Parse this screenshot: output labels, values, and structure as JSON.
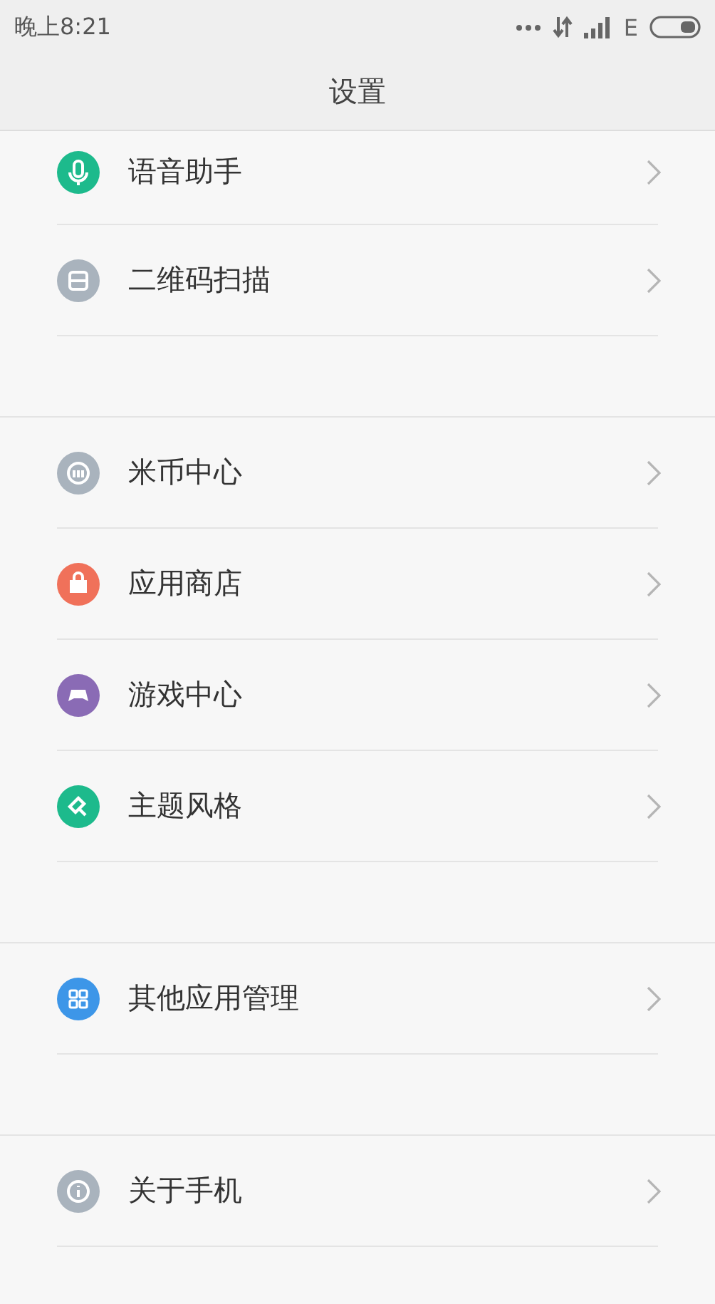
{
  "status_bar": {
    "time": "晚上8:21",
    "network_type": "E"
  },
  "title": "设置",
  "groups": [
    {
      "items": [
        {
          "label": "语音助手",
          "color": "#1dba8c"
        },
        {
          "label": "二维码扫描",
          "color": "#a9b3bd"
        }
      ]
    },
    {
      "items": [
        {
          "label": "米币中心",
          "color": "#a9b3bd"
        },
        {
          "label": "应用商店",
          "color": "#f0715a"
        },
        {
          "label": "游戏中心",
          "color": "#8a6bb5"
        },
        {
          "label": "主题风格",
          "color": "#1dba8c"
        }
      ]
    },
    {
      "items": [
        {
          "label": "其他应用管理",
          "color": "#3d96e8"
        }
      ]
    },
    {
      "items": [
        {
          "label": "关于手机",
          "color": "#a9b3bd"
        }
      ]
    }
  ]
}
